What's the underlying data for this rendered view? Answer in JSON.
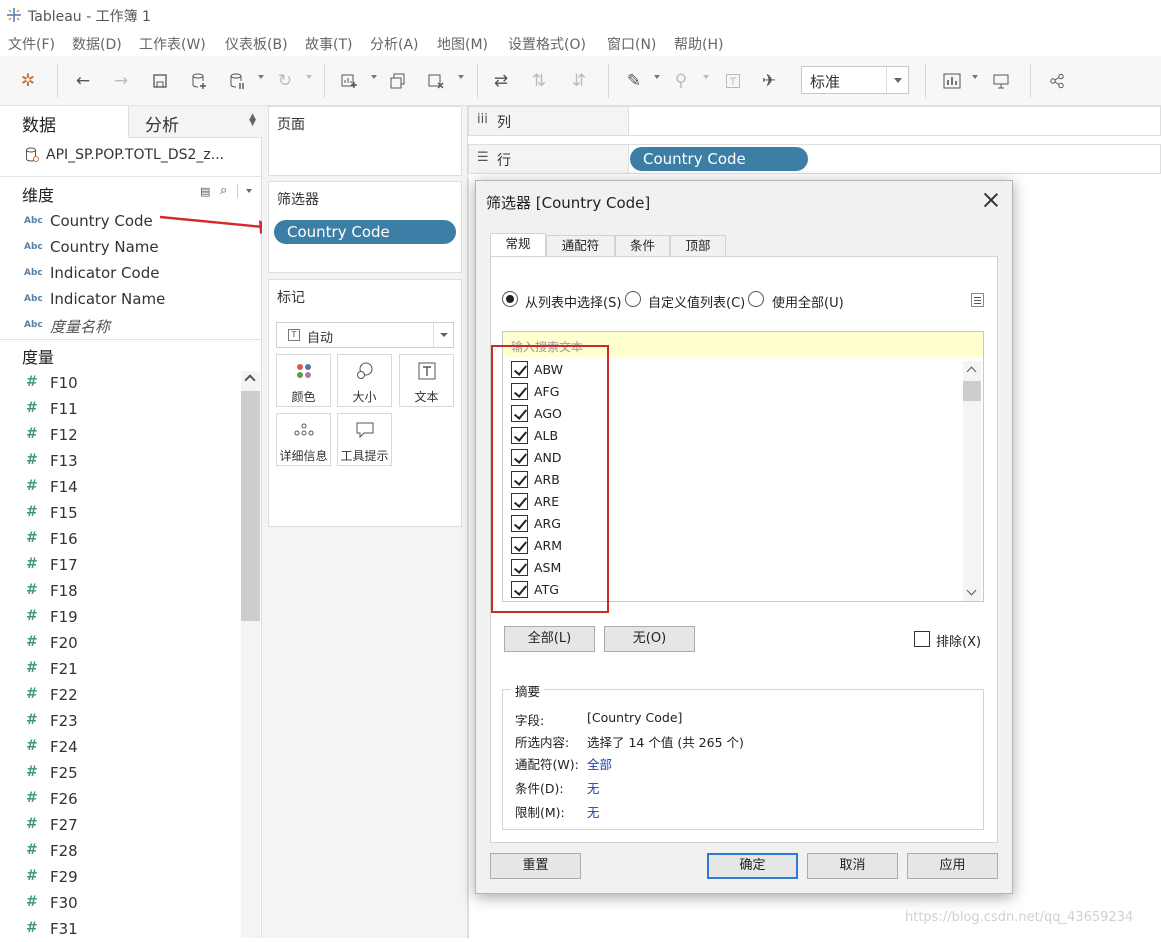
{
  "window": {
    "title": "Tableau - 工作簿 1"
  },
  "menu": [
    "文件(F)",
    "数据(D)",
    "工作表(W)",
    "仪表板(B)",
    "故事(T)",
    "分析(A)",
    "地图(M)",
    "设置格式(O)",
    "窗口(N)",
    "帮助(H)"
  ],
  "toolbar": {
    "fit_select": "标准"
  },
  "data_pane": {
    "tabs": {
      "data": "数据",
      "analysis": "分析"
    },
    "datasource": "API_SP.POP.TOTL_DS2_z...",
    "dimensions_title": "维度",
    "dimensions": [
      "Country Code",
      "Country Name",
      "Indicator Code",
      "Indicator Name",
      "度量名称"
    ],
    "measures_title": "度量",
    "measures": [
      "F10",
      "F11",
      "F12",
      "F13",
      "F14",
      "F15",
      "F16",
      "F17",
      "F18",
      "F19",
      "F20",
      "F21",
      "F22",
      "F23",
      "F24",
      "F25",
      "F26",
      "F27",
      "F28",
      "F29",
      "F30",
      "F31"
    ]
  },
  "cards": {
    "pages": "页面",
    "filters": "筛选器",
    "filter_pill": "Country Code",
    "marks": "标记",
    "marks_type": "自动",
    "marks_buttons": [
      "颜色",
      "大小",
      "文本",
      "详细信息",
      "工具提示"
    ]
  },
  "shelves": {
    "columns_label": "列",
    "rows_label": "行",
    "rows_pill": "Country Code"
  },
  "dialog": {
    "title": "筛选器 [Country Code]",
    "tabs": [
      "常规",
      "通配符",
      "条件",
      "顶部"
    ],
    "radios": [
      "从列表中选择(S)",
      "自定义值列表(C)",
      "使用全部(U)"
    ],
    "search_placeholder": "输入搜索文本",
    "items": [
      "ABW",
      "AFG",
      "AGO",
      "ALB",
      "AND",
      "ARB",
      "ARE",
      "ARG",
      "ARM",
      "ASM",
      "ATG"
    ],
    "btn_all": "全部(L)",
    "btn_none": "无(O)",
    "exclude": "排除(X)",
    "summary": {
      "title": "摘要",
      "field_key": "字段:",
      "field_val": "[Country Code]",
      "sel_key": "所选内容:",
      "sel_val": "选择了 14 个值 (共 265 个)",
      "wild_key": "通配符(W):",
      "wild_val": "全部",
      "cond_key": "条件(D):",
      "cond_val": "无",
      "limit_key": "限制(M):",
      "limit_val": "无"
    },
    "btn_reset": "重置",
    "btn_ok": "确定",
    "btn_cancel": "取消",
    "btn_apply": "应用"
  },
  "watermark": "https://blog.csdn.net/qq_43659234"
}
